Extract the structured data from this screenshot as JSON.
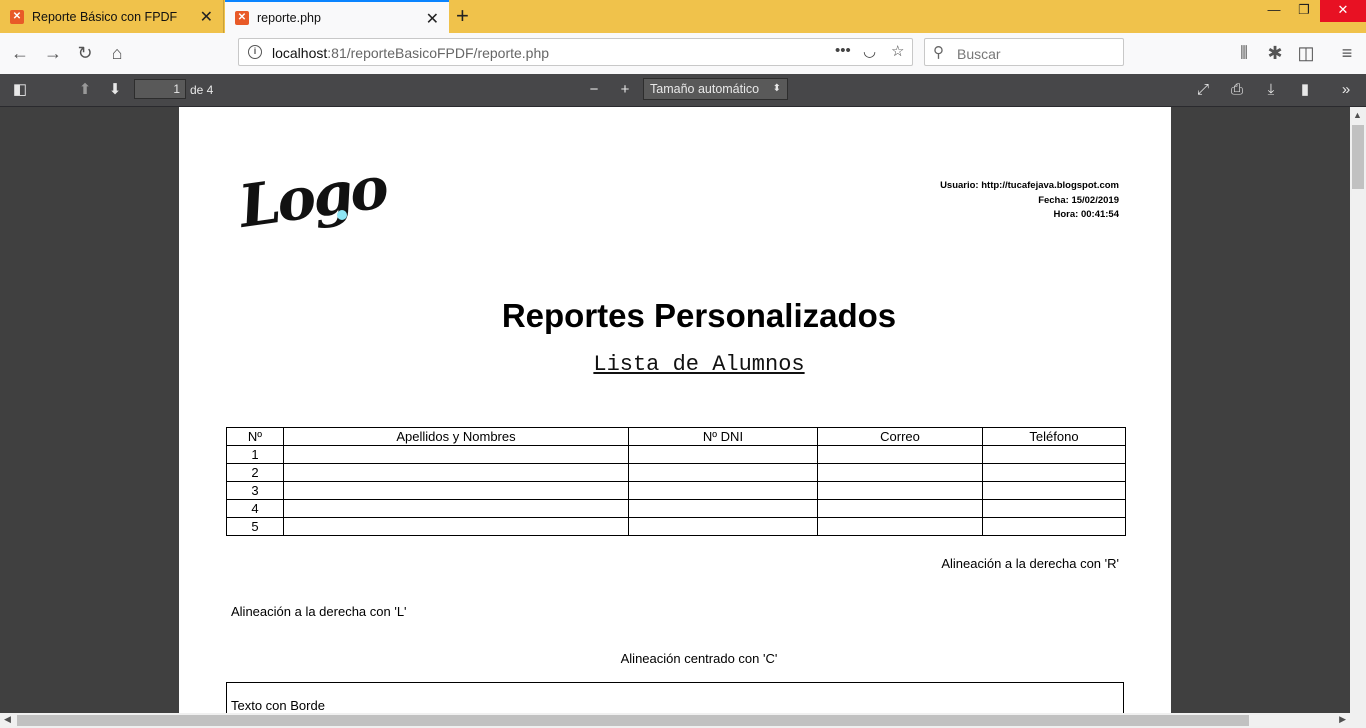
{
  "browser": {
    "tabs": [
      {
        "title": "Reporte Básico con FPDF",
        "active": false
      },
      {
        "title": "reporte.php",
        "active": true
      }
    ],
    "url_host": "localhost",
    "url_path": ":81/reporteBasicoFPDF/reporte.php",
    "search_placeholder": "Buscar"
  },
  "pdf_toolbar": {
    "page_number": "1",
    "of_pages": "de 4",
    "zoom": "Tamaño automático"
  },
  "report": {
    "logo_text": "Logo",
    "meta": {
      "usuario": "Usuario: http://tucafejava.blogspot.com",
      "fecha": "Fecha: 15/02/2019",
      "hora": "Hora: 00:41:54"
    },
    "title": "Reportes Personalizados",
    "subtitle": "Lista de Alumnos",
    "table": {
      "headers": [
        "Nº",
        "Apellidos y Nombres",
        "Nº DNI",
        "Correo",
        "Teléfono"
      ],
      "rows": [
        [
          "1",
          "",
          "",
          "",
          ""
        ],
        [
          "2",
          "",
          "",
          "",
          ""
        ],
        [
          "3",
          "",
          "",
          "",
          ""
        ],
        [
          "4",
          "",
          "",
          "",
          ""
        ],
        [
          "5",
          "",
          "",
          "",
          ""
        ]
      ]
    },
    "align_right": "Alineación a la derecha con 'R'",
    "align_left": "Alineación a la derecha con 'L'",
    "align_center": "Alineación centrado con 'C'",
    "bordered_text": "Texto con Borde"
  }
}
